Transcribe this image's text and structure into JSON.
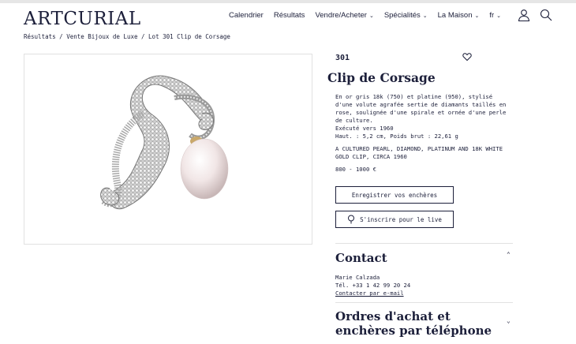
{
  "header": {
    "logo": "ARTCURIAL",
    "nav": [
      {
        "label": "Calendrier",
        "dropdown": false
      },
      {
        "label": "Résultats",
        "dropdown": false
      },
      {
        "label": "Vendre/Acheter",
        "dropdown": true
      },
      {
        "label": "Spécialités",
        "dropdown": true
      },
      {
        "label": "La Maison",
        "dropdown": true
      },
      {
        "label": "fr",
        "dropdown": true
      }
    ],
    "icons": [
      "user-icon",
      "search-icon"
    ]
  },
  "breadcrumb": {
    "items": [
      "Résultats",
      "Vente Bijoux de Luxe",
      "Lot 301 Clip de Corsage"
    ],
    "separator": " / "
  },
  "lot": {
    "number": "301",
    "title": "Clip de Corsage",
    "description_fr": "En or gris 18k (750) et platine (950), stylisé d'une volute agrafée sertie de diamants taillés en rose, soulignée d'une spirale et ornée d'une perle de culture.",
    "executed": "Exécuté vers 1960",
    "dimensions": "Haut. : 5,2 cm, Poids brut : 22,61 g",
    "description_en": "A CULTURED PEARL, DIAMOND, PLATINUM AND 18K WHITE GOLD CLIP, CIRCA 1960",
    "estimate": "800 - 1000 €"
  },
  "actions": {
    "register_label": "Enregistrer vos enchères",
    "live_label": "S'inscrire pour le live"
  },
  "contact": {
    "title": "Contact",
    "name": "Marie Calzada",
    "phone": "Tél. +33 1 42 99 20 24",
    "email_link": "Contacter par e-mail"
  },
  "ordres": {
    "title": "Ordres d'achat et enchères par téléphone"
  },
  "colors": {
    "text": "#1c1f3a",
    "border": "#e1e1e1",
    "background": "#ffffff"
  }
}
